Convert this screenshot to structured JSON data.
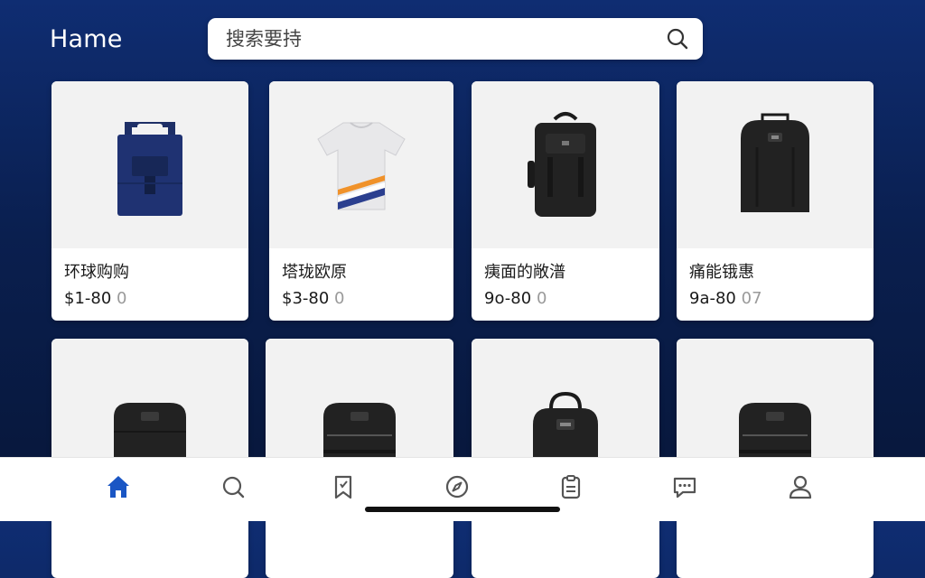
{
  "header": {
    "title": "Hame"
  },
  "search": {
    "placeholder": "搜索要持"
  },
  "products": [
    {
      "name": "环球购购",
      "price": "$1-80",
      "price_dim": "0",
      "image": "navy-tote-backpack"
    },
    {
      "name": "塔珑欧原",
      "price": "$3-80",
      "price_dim": "0",
      "image": "striped-tshirt"
    },
    {
      "name": "痍面的敞潽",
      "price": "9o-80",
      "price_dim": "0",
      "image": "black-backpack"
    },
    {
      "name": "痛能锇惠",
      "price": "9a-80",
      "price_dim": "07",
      "image": "black-backpack"
    },
    {
      "name": "",
      "price": "",
      "price_dim": "",
      "image": "black-backpack"
    },
    {
      "name": "",
      "price": "",
      "price_dim": "",
      "image": "black-backpack"
    },
    {
      "name": "",
      "price": "",
      "price_dim": "",
      "image": "black-backpack"
    },
    {
      "name": "",
      "price": "",
      "price_dim": "",
      "image": "black-backpack"
    }
  ],
  "nav": {
    "items": [
      {
        "icon": "home-icon",
        "active": true
      },
      {
        "icon": "search-icon",
        "active": false
      },
      {
        "icon": "bookmark-icon",
        "active": false
      },
      {
        "icon": "compass-icon",
        "active": false
      },
      {
        "icon": "clipboard-icon",
        "active": false
      },
      {
        "icon": "chat-icon",
        "active": false
      },
      {
        "icon": "profile-icon",
        "active": false
      }
    ],
    "active_color": "#1a56c4",
    "inactive_color": "#555555"
  },
  "colors": {
    "background": "#0a1f4f",
    "card": "#ffffff"
  }
}
